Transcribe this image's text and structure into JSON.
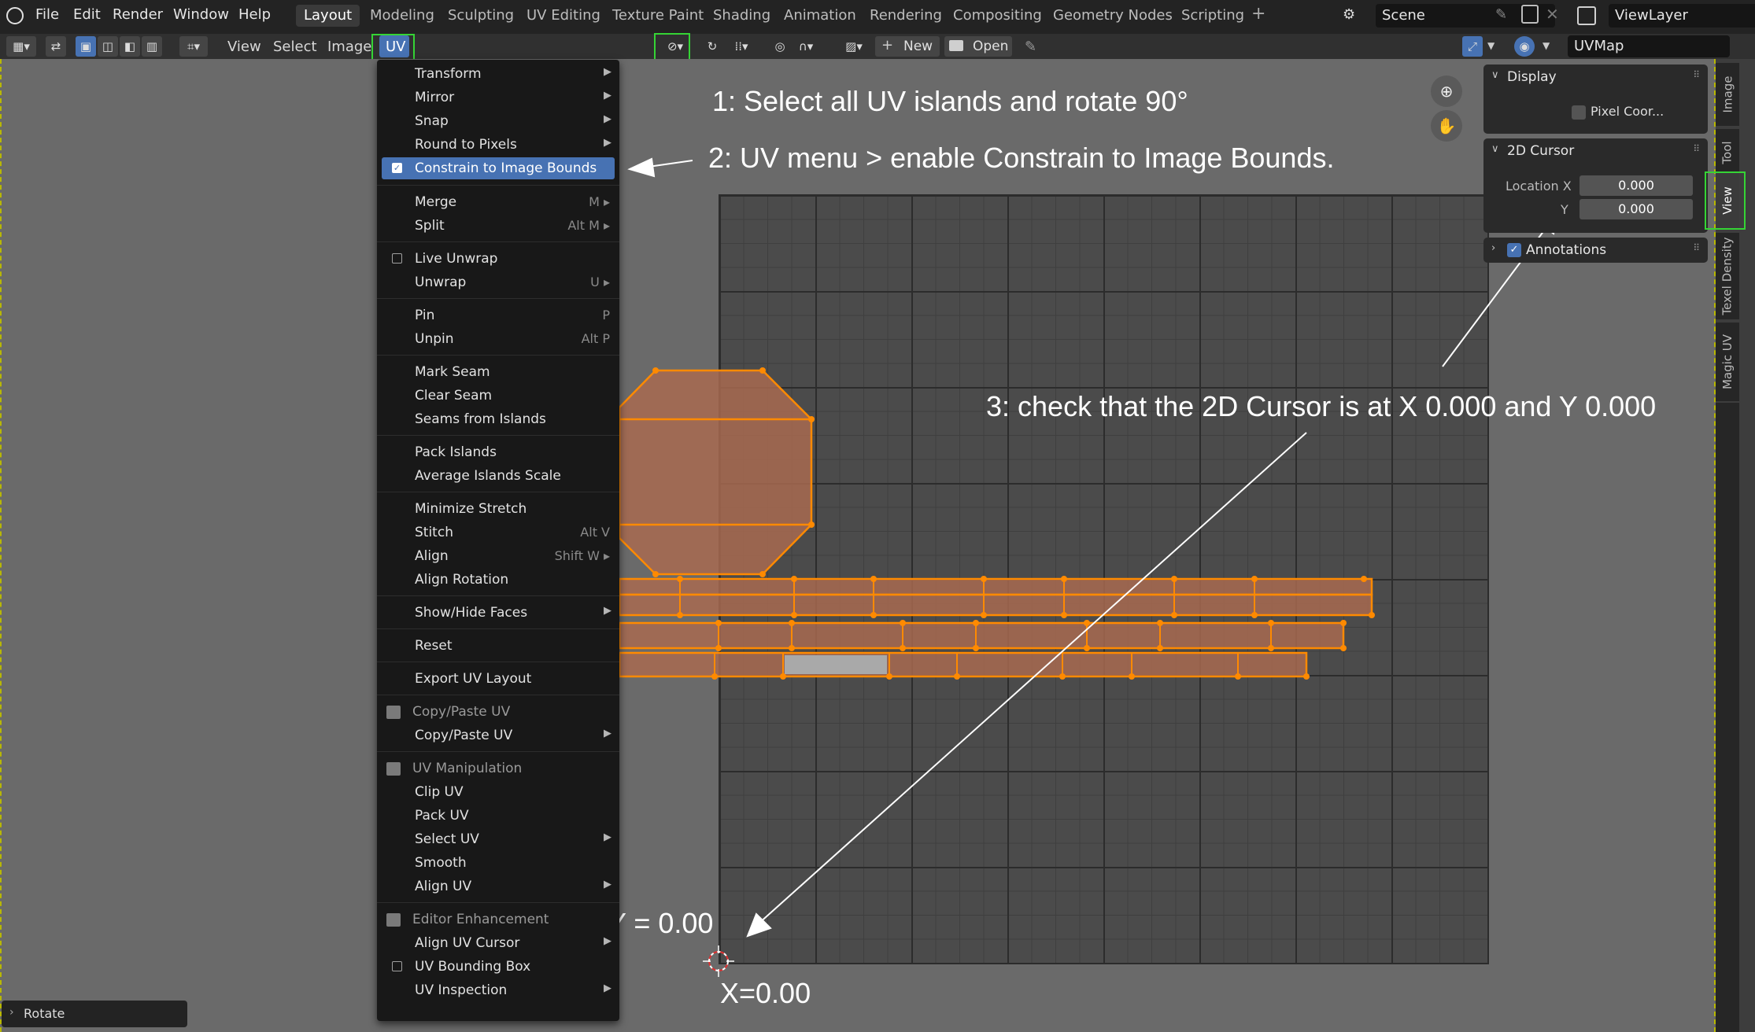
{
  "topbar": {
    "menus": [
      "File",
      "Edit",
      "Render",
      "Window",
      "Help"
    ],
    "workspaces": [
      "Layout",
      "Modeling",
      "Sculpting",
      "UV Editing",
      "Texture Paint",
      "Shading",
      "Animation",
      "Rendering",
      "Compositing",
      "Geometry Nodes",
      "Scripting"
    ],
    "add_tab": "+",
    "scene": "Scene",
    "view_layer": "ViewLayer"
  },
  "header": {
    "menus": [
      "View",
      "Select",
      "Image",
      "UV"
    ],
    "new_label": "New",
    "open_label": "Open",
    "uv_map": "UVMap"
  },
  "uv_menu": {
    "items": [
      {
        "label": "Transform",
        "submenu": true
      },
      {
        "label": "Mirror",
        "submenu": true
      },
      {
        "label": "Snap",
        "submenu": true
      },
      {
        "label": "Round to Pixels",
        "submenu": true
      },
      {
        "label": "Constrain to Image Bounds",
        "checked": true,
        "selected": true
      },
      {
        "label": "Merge",
        "shortcut": "M ▸"
      },
      {
        "label": "Split",
        "shortcut": "Alt M ▸"
      },
      {
        "label": "Live Unwrap",
        "checked": false
      },
      {
        "label": "Unwrap",
        "shortcut": "U ▸"
      },
      {
        "label": "Pin",
        "shortcut": "P"
      },
      {
        "label": "Unpin",
        "shortcut": "Alt P"
      },
      {
        "label": "Mark Seam"
      },
      {
        "label": "Clear Seam"
      },
      {
        "label": "Seams from Islands"
      },
      {
        "label": "Pack Islands"
      },
      {
        "label": "Average Islands Scale"
      },
      {
        "label": "Minimize Stretch"
      },
      {
        "label": "Stitch",
        "shortcut": "Alt V"
      },
      {
        "label": "Align",
        "shortcut": "Shift W ▸"
      },
      {
        "label": "Align Rotation"
      },
      {
        "label": "Show/Hide Faces",
        "submenu": true
      },
      {
        "label": "Reset"
      },
      {
        "label": "Export UV Layout"
      },
      {
        "label": "Copy/Paste UV",
        "section": true
      },
      {
        "label": "Copy/Paste UV",
        "submenu": true
      },
      {
        "label": "UV Manipulation",
        "section": true
      },
      {
        "label": "Clip UV"
      },
      {
        "label": "Pack UV"
      },
      {
        "label": "Select UV",
        "submenu": true
      },
      {
        "label": "Smooth"
      },
      {
        "label": "Align UV",
        "submenu": true
      },
      {
        "label": "Editor Enhancement",
        "section": true
      },
      {
        "label": "Align UV Cursor",
        "submenu": true
      },
      {
        "label": "UV Bounding Box",
        "checked": false
      },
      {
        "label": "UV Inspection",
        "submenu": true
      }
    ]
  },
  "sidebar": {
    "display_title": "Display",
    "pixel_coords_label": "Pixel Coor...",
    "cursor_title": "2D Cursor",
    "location_x_label": "Location X",
    "location_y_label": "Y",
    "location_x_value": "0.000",
    "location_y_value": "0.000",
    "annotations_label": "Annotations",
    "tabs": [
      "Image",
      "Tool",
      "View",
      "Texel Density",
      "Magic UV"
    ]
  },
  "annotations": {
    "step1": "1: Select all UV islands and rotate 90°",
    "step2": "2: UV menu > enable Constrain to Image Bounds.",
    "step3": "3: check that the 2D Cursor is at X 0.000 and Y 0.000",
    "y_label": "Y = 0.00",
    "x_label": "X=0.00"
  },
  "last_op": "Rotate",
  "colors": {
    "accent": "#4772b3",
    "highlight_box": "#35d435",
    "uv_face": "#a86a50",
    "uv_edge": "#ff8a00"
  }
}
